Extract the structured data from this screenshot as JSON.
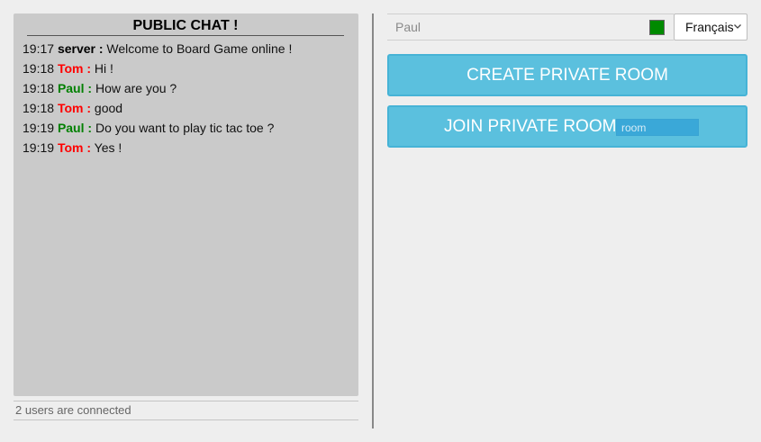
{
  "chat": {
    "title": "PUBLIC CHAT !",
    "messages": [
      {
        "time": "19:17",
        "author": "server :",
        "author_color": "#000000",
        "text": "Welcome to Board Game online !"
      },
      {
        "time": "19:18",
        "author": "Tom :",
        "author_color": "#ff0000",
        "text": "Hi !"
      },
      {
        "time": "19:18",
        "author": "Paul :",
        "author_color": "#008000",
        "text": "How are you ?"
      },
      {
        "time": "19:18",
        "author": "Tom :",
        "author_color": "#ff0000",
        "text": "good"
      },
      {
        "time": "19:19",
        "author": "Paul :",
        "author_color": "#008000",
        "text": "Do you want to play tic tac toe ?"
      },
      {
        "time": "19:19",
        "author": "Tom :",
        "author_color": "#ff0000",
        "text": "Yes !"
      }
    ],
    "status": "2 users are connected"
  },
  "user": {
    "name": "Paul",
    "color": "#008a00"
  },
  "language": {
    "selected": "Français"
  },
  "buttons": {
    "create_label": "CREATE PRIVATE ROOM",
    "join_label": "JOIN PRIVATE ROOM",
    "room_placeholder": "room"
  },
  "colors": {
    "button_bg": "#5bc0de",
    "panel_bg": "#cacaca",
    "page_bg": "#eeeeee"
  }
}
